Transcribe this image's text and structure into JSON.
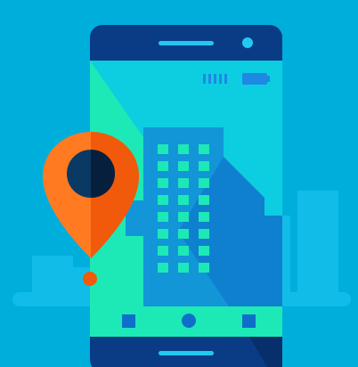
{
  "colors": {
    "background": "#00aedc",
    "skyline": "#11bde8",
    "phone_body": "#0a3c86",
    "phone_body_shadow": "#072f6b",
    "screen_teal": "#1de9b6",
    "screen_cyan": "#0dcde0",
    "screen_blue": "#0b7ad6",
    "building": "#1296d8",
    "building_shadow": "#0d6fc9",
    "windows": "#1de9b6",
    "accent_cyan": "#23c8f0",
    "battery": "#1e88e5",
    "pin_light": "#ff7a21",
    "pin_dark": "#f05a0a",
    "pin_hole": "#0a3a63",
    "pin_hole_shadow": "#061f3d"
  },
  "icons": {
    "phone": "smartphone-icon",
    "speaker": "speaker-grille-icon",
    "camera": "front-camera-icon",
    "signal": "signal-bars-icon",
    "battery": "battery-icon",
    "pin": "map-pin-icon",
    "nav_back": "square-nav-icon",
    "nav_home": "circle-home-icon",
    "nav_recent": "square-recent-icon"
  },
  "building": {
    "window_columns": 3,
    "window_rows": 8
  }
}
